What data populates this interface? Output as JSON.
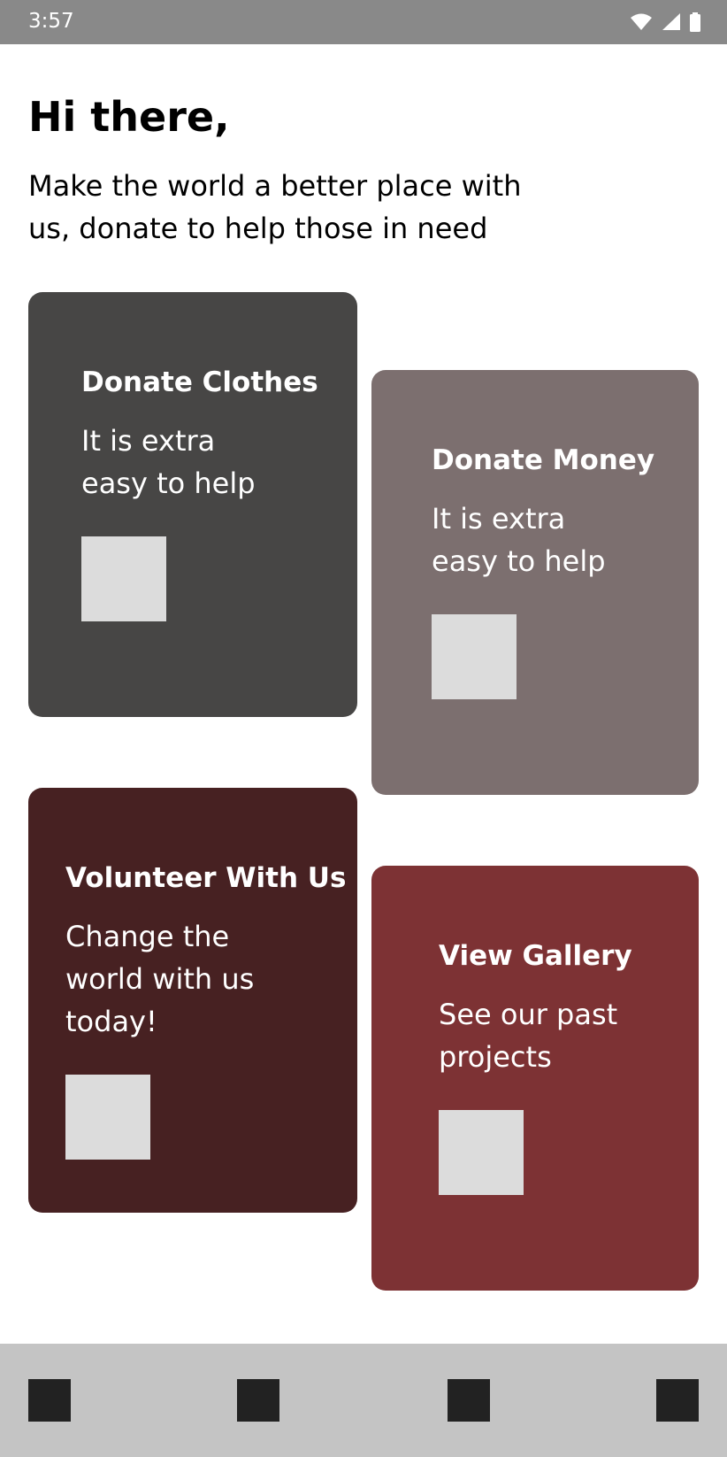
{
  "status_bar": {
    "time": "3:57",
    "icons": [
      "wifi-icon",
      "signal-icon",
      "battery-icon"
    ]
  },
  "header": {
    "greeting": "Hi there,",
    "subtitle": "Make the world a better place with us, donate to help those in need"
  },
  "cards": [
    {
      "id": "donate-clothes",
      "title": "Donate Clothes",
      "description": "It is extra easy to help",
      "color": "#474645",
      "icon": "placeholder-icon"
    },
    {
      "id": "donate-money",
      "title": "Donate Money",
      "description": "It is extra easy to help",
      "color": "#7c6f6f",
      "icon": "placeholder-icon"
    },
    {
      "id": "volunteer",
      "title": "Volunteer With Us",
      "description": "Change the world with us today!",
      "color": "#472122",
      "icon": "placeholder-icon"
    },
    {
      "id": "gallery",
      "title": "View Gallery",
      "description": "See our past projects",
      "color": "#7d3234",
      "icon": "placeholder-icon"
    }
  ],
  "bottom_nav": {
    "background": "#c4c4c4",
    "items": [
      "nav-icon-1",
      "nav-icon-2",
      "nav-icon-3",
      "nav-icon-4"
    ]
  }
}
